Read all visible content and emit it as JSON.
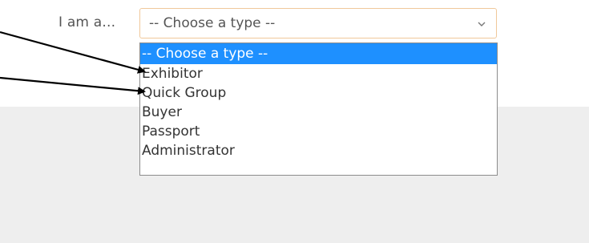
{
  "form": {
    "label": "I am a...",
    "select": {
      "value": "-- Choose a type --",
      "chevron_icon": "chevron-down-icon",
      "accent_border": "#f0c89a"
    },
    "options": [
      {
        "label": "-- Choose a type --",
        "selected": true
      },
      {
        "label": "Exhibitor",
        "selected": false
      },
      {
        "label": "Quick Group",
        "selected": false
      },
      {
        "label": "Buyer",
        "selected": false
      },
      {
        "label": "Passport",
        "selected": false
      },
      {
        "label": "Administrator",
        "selected": false
      }
    ],
    "highlight_color": "#1e90ff"
  },
  "annotations": {
    "arrows": [
      {
        "points_to": "Exhibitor"
      },
      {
        "points_to": "Quick Group"
      }
    ]
  }
}
